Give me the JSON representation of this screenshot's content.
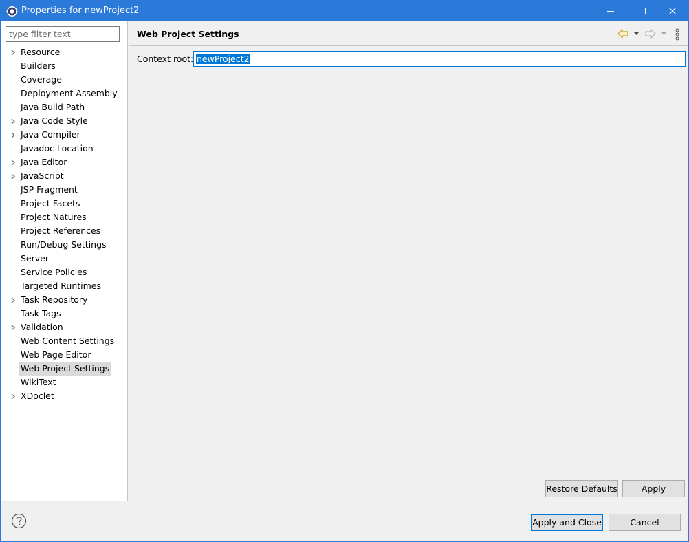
{
  "window": {
    "title": "Properties for newProject2"
  },
  "filter": {
    "placeholder": "type filter text"
  },
  "tree": {
    "items": [
      {
        "label": "Resource",
        "expandable": true
      },
      {
        "label": "Builders",
        "expandable": false
      },
      {
        "label": "Coverage",
        "expandable": false
      },
      {
        "label": "Deployment Assembly",
        "expandable": false
      },
      {
        "label": "Java Build Path",
        "expandable": false
      },
      {
        "label": "Java Code Style",
        "expandable": true
      },
      {
        "label": "Java Compiler",
        "expandable": true
      },
      {
        "label": "Javadoc Location",
        "expandable": false
      },
      {
        "label": "Java Editor",
        "expandable": true
      },
      {
        "label": "JavaScript",
        "expandable": true
      },
      {
        "label": "JSP Fragment",
        "expandable": false
      },
      {
        "label": "Project Facets",
        "expandable": false
      },
      {
        "label": "Project Natures",
        "expandable": false
      },
      {
        "label": "Project References",
        "expandable": false
      },
      {
        "label": "Run/Debug Settings",
        "expandable": false
      },
      {
        "label": "Server",
        "expandable": false
      },
      {
        "label": "Service Policies",
        "expandable": false
      },
      {
        "label": "Targeted Runtimes",
        "expandable": false
      },
      {
        "label": "Task Repository",
        "expandable": true
      },
      {
        "label": "Task Tags",
        "expandable": false
      },
      {
        "label": "Validation",
        "expandable": true
      },
      {
        "label": "Web Content Settings",
        "expandable": false
      },
      {
        "label": "Web Page Editor",
        "expandable": false
      },
      {
        "label": "Web Project Settings",
        "expandable": false,
        "selected": true
      },
      {
        "label": "WikiText",
        "expandable": false
      },
      {
        "label": "XDoclet",
        "expandable": true
      }
    ]
  },
  "page": {
    "title": "Web Project Settings",
    "context_root_label": "Context root:",
    "context_root_value": "newProject2"
  },
  "buttons": {
    "restore_defaults": "Restore Defaults",
    "apply": "Apply",
    "apply_and_close": "Apply and Close",
    "cancel": "Cancel"
  },
  "colors": {
    "titlebar": "#2b79d9",
    "selection": "#0078d7",
    "nav_back_arrow": "#d4b84a"
  }
}
